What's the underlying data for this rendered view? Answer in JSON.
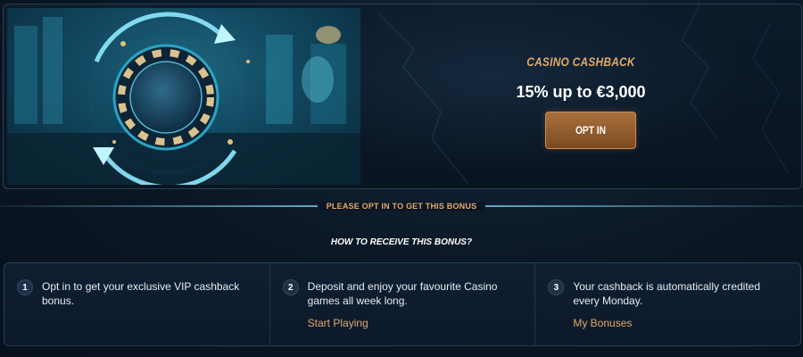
{
  "promo": {
    "category": "CASINO CASHBACK",
    "headline": "15% up to €3,000",
    "opt_in_label": "OPT IN",
    "image_alt": "casino chip with cashback arrows"
  },
  "notice": {
    "text": "PLEASE OPT IN TO GET THIS BONUS"
  },
  "howto": {
    "heading": "HOW TO RECEIVE THIS BONUS?",
    "steps": [
      {
        "number": "1",
        "text": "Opt in to get your exclusive VIP cashback bonus.",
        "link": ""
      },
      {
        "number": "2",
        "text": "Deposit and enjoy your favourite Casino games all week long.",
        "link": "Start Playing"
      },
      {
        "number": "3",
        "text": "Your cashback is automatically credited every Monday.",
        "link": "My Bonuses"
      }
    ]
  },
  "colors": {
    "accent_gold": "#e2a96a",
    "background": "#0b1624",
    "button_gradient_top": "#a9713f",
    "button_gradient_bottom": "#7c4a20",
    "divider_cyan": "#6fb9d6"
  }
}
